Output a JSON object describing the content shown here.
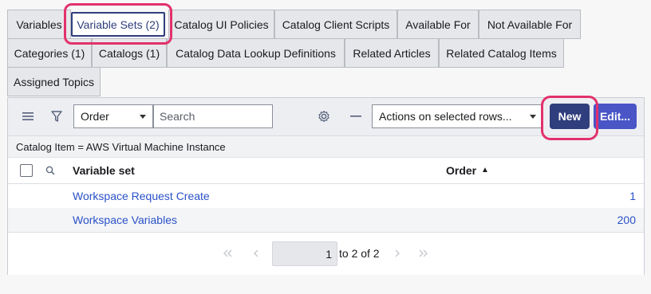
{
  "tabs": [
    {
      "label": "Variables"
    },
    {
      "label": "Variable Sets (2)"
    },
    {
      "label": "Catalog UI Policies"
    },
    {
      "label": "Catalog Client Scripts"
    },
    {
      "label": "Available For"
    },
    {
      "label": "Not Available For"
    },
    {
      "label": "Categories (1)"
    },
    {
      "label": "Catalogs (1)"
    },
    {
      "label": "Catalog Data Lookup Definitions"
    },
    {
      "label": "Related Articles"
    },
    {
      "label": "Related Catalog Items"
    },
    {
      "label": "Assigned Topics"
    }
  ],
  "toolbar": {
    "field_select": "Order",
    "search_placeholder": "Search",
    "actions_select": "Actions on selected rows...",
    "new_label": "New",
    "edit_label": "Edit..."
  },
  "filter": {
    "text": "Catalog Item = AWS Virtual Machine Instance"
  },
  "table": {
    "columns": [
      "Variable set",
      "Order"
    ],
    "sort_indicator": "▲",
    "rows": [
      {
        "name": "Workspace Request Create",
        "order": "1"
      },
      {
        "name": "Workspace Variables",
        "order": "200"
      }
    ]
  },
  "pager": {
    "page_value": "1",
    "range_text": "to 2 of 2"
  },
  "colors": {
    "accent": "#2f3e7c",
    "highlight": "#e2316b",
    "link": "#2a51c8",
    "edit_button": "#4a55c6"
  }
}
